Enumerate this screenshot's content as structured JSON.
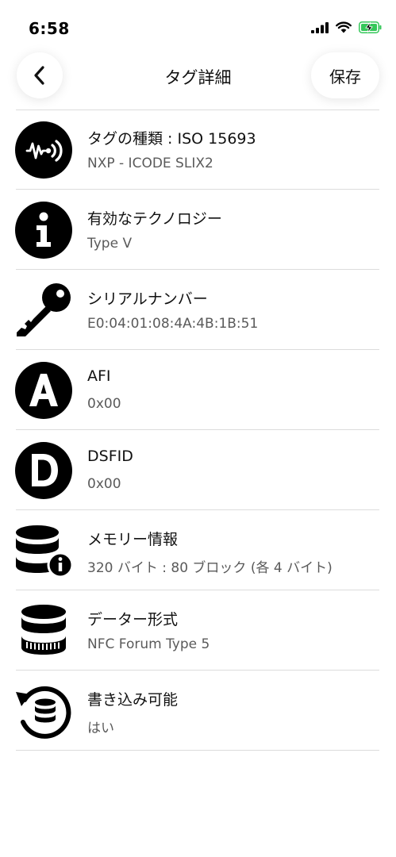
{
  "status_bar": {
    "time": "6:58"
  },
  "nav": {
    "back_icon": "chevron-left-icon",
    "title": "タグ詳細",
    "save_label": "保存"
  },
  "rows": [
    {
      "icon": "nfc-wave-icon",
      "title": "タグの種類 : ISO 15693",
      "subtitle": "NXP - ICODE SLIX2"
    },
    {
      "icon": "info-icon",
      "title": "有効なテクノロジー",
      "subtitle": "Type V"
    },
    {
      "icon": "key-icon",
      "title": "シリアルナンバー",
      "subtitle": "E0:04:01:08:4A:4B:1B:51"
    },
    {
      "icon": "letter-a-icon",
      "title": "AFI",
      "subtitle": "0x00"
    },
    {
      "icon": "letter-d-icon",
      "title": "DSFID",
      "subtitle": "0x00"
    },
    {
      "icon": "database-info-icon",
      "title": "メモリー情報",
      "subtitle": "320 バイト : 80 ブロック (各 4 バイト)"
    },
    {
      "icon": "database-icon",
      "title": "データー形式",
      "subtitle": "NFC Forum Type 5"
    },
    {
      "icon": "database-rewrite-icon",
      "title": "書き込み可能",
      "subtitle": "はい"
    }
  ]
}
